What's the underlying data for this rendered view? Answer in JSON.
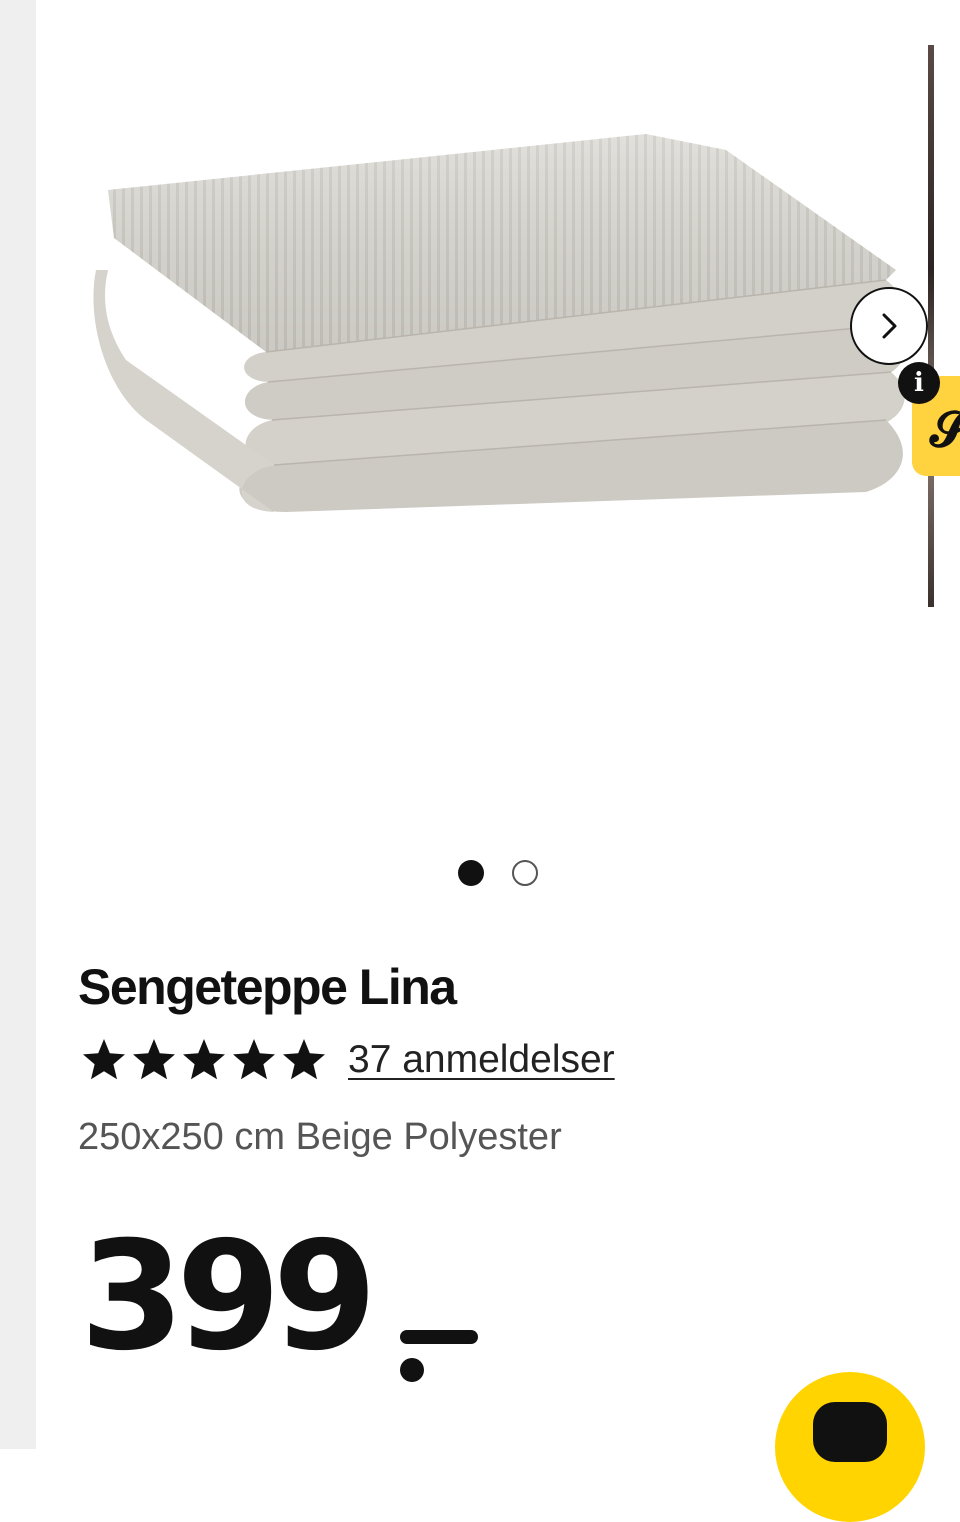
{
  "gallery": {
    "image_alt": "Sengeteppe Lina",
    "slide_count": 2,
    "active_index": 0,
    "info_label": "i"
  },
  "product": {
    "title": "Sengeteppe Lina",
    "rating": {
      "stars": 5,
      "max": 5
    },
    "review_link": "37 anmeldelser",
    "variant": "250x250 cm Beige Polyester",
    "price_number": "399"
  },
  "colors": {
    "accent_yellow": "#ffd400",
    "text": "#111111",
    "muted": "#555555"
  }
}
